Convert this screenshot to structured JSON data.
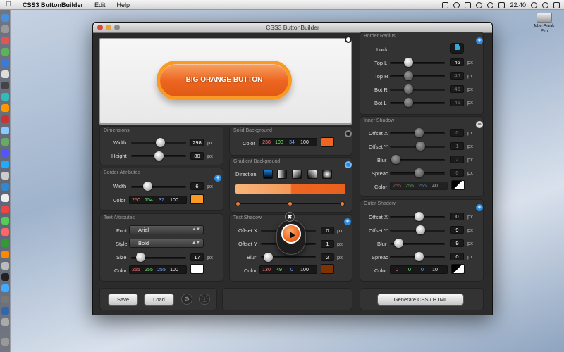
{
  "menubar": {
    "app": "CSS3 ButtonBuilder",
    "edit": "Edit",
    "help": "Help",
    "clock": "22:40"
  },
  "desktop": {
    "disk_label": "MacBook Pro"
  },
  "window": {
    "title": "CSS3 ButtonBuilder"
  },
  "preview": {
    "button_label": "BIG ORANGE BUTTON"
  },
  "unit": "px",
  "dimensions": {
    "title": "Dimensions",
    "width_label": "Width",
    "width": "298",
    "height_label": "Height",
    "height": "80"
  },
  "border_attr": {
    "title": "Border Attributes",
    "width_label": "Width",
    "width": "6",
    "color_label": "Color",
    "color": [
      "250",
      "154",
      "37",
      "100"
    ],
    "swatch": "#fa9a25"
  },
  "text_attr": {
    "title": "Text Attributes",
    "font_label": "Font",
    "font": "Arial",
    "style_label": "Style",
    "style": "Bold",
    "size_label": "Size",
    "size": "17",
    "color_label": "Color",
    "color": [
      "255",
      "255",
      "255",
      "100"
    ],
    "swatch": "#ffffff"
  },
  "solid_bg": {
    "title": "Solid Background",
    "color_label": "Color",
    "color": [
      "238",
      "103",
      "34",
      "100"
    ],
    "swatch": "#ee6722"
  },
  "gradient_bg": {
    "title": "Gradient Background",
    "direction_label": "Direction"
  },
  "text_shadow": {
    "title": "Text Shadow",
    "offx_label": "Offset X",
    "offx": "0",
    "offy_label": "Offset Y",
    "offy": "1",
    "blur_label": "Blur",
    "blur": "2",
    "color_label": "Color",
    "color": [
      "130",
      "49",
      "0",
      "100"
    ],
    "swatch": "#823100"
  },
  "border_radius": {
    "title": "Border Radius",
    "lock_label": "Lock",
    "topl_label": "Top L",
    "topl": "46",
    "topr_label": "Top R",
    "topr": "46",
    "botr_label": "Bot R",
    "botr": "46",
    "botl_label": "Bot L",
    "botl": "46"
  },
  "inner_shadow": {
    "title": "Inner Shadow",
    "offx_label": "Offset X",
    "offx": "0",
    "offy_label": "Offset Y",
    "offy": "1",
    "blur_label": "Blur",
    "blur": "2",
    "spread_label": "Spread",
    "spread": "0",
    "color_label": "Color",
    "color": [
      "255",
      "255",
      "255",
      "40"
    ]
  },
  "outer_shadow": {
    "title": "Outer Shadow",
    "offx_label": "Offset X",
    "offx": "0",
    "offy_label": "Offset Y",
    "offy": "9",
    "blur_label": "Blur",
    "blur": "9",
    "spread_label": "Spread",
    "spread": "0",
    "color_label": "Color",
    "color": [
      "0",
      "0",
      "0",
      "10"
    ]
  },
  "footer": {
    "save": "Save",
    "load": "Load",
    "generate": "Generate CSS / HTML"
  }
}
